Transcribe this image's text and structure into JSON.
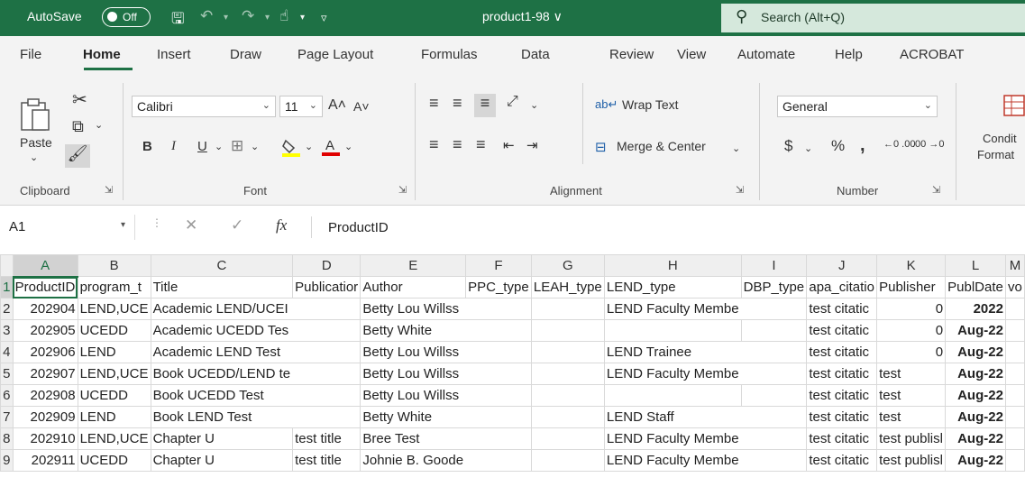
{
  "titlebar": {
    "autosave_label": "AutoSave",
    "autosave_state": "Off",
    "doc_title": "product1-98 ∨",
    "search_placeholder": "Search (Alt+Q)"
  },
  "menu": {
    "tabs": [
      "File",
      "Home",
      "Insert",
      "Draw",
      "Page Layout",
      "Formulas",
      "Data",
      "Review",
      "View",
      "Automate",
      "Help",
      "ACROBAT"
    ],
    "active": "Home"
  },
  "ribbon": {
    "clipboard": {
      "paste_label": "Paste",
      "group_label": "Clipboard"
    },
    "font": {
      "name": "Calibri",
      "size": "11",
      "group_label": "Font"
    },
    "alignment": {
      "wrap_text": "Wrap Text",
      "merge_center": "Merge & Center",
      "group_label": "Alignment"
    },
    "number": {
      "format": "General",
      "group_label": "Number"
    },
    "styles": {
      "conditional_line1": "Condit",
      "conditional_line2": "Format"
    }
  },
  "formula_bar": {
    "name_box": "A1",
    "fx_label": "fx",
    "content": "ProductID"
  },
  "grid": {
    "columns": [
      "A",
      "B",
      "C",
      "D",
      "E",
      "F",
      "G",
      "H",
      "I",
      "J",
      "K",
      "L",
      "M"
    ],
    "rows": [
      [
        "1",
        "ProductID",
        "program_t",
        "Title",
        "Publicatior",
        "Author",
        "PPC_type",
        "LEAH_type",
        "LEND_type",
        "DBP_type",
        "apa_citatio",
        "Publisher",
        "PublDate",
        "vo"
      ],
      [
        "2",
        "202904",
        "LEND,UCE",
        "Academic LEND/UCEI",
        "",
        "Betty Lou Willss",
        "",
        "",
        "LEND Faculty Membe",
        "",
        "test citatic",
        "0",
        "2022",
        ""
      ],
      [
        "3",
        "202905",
        "UCEDD",
        "Academic UCEDD Tes",
        "",
        "Betty White",
        "",
        "",
        "",
        "",
        "test citatic",
        "0",
        "Aug-22",
        ""
      ],
      [
        "4",
        "202906",
        "LEND",
        "Academic LEND Test",
        "",
        "Betty Lou Willss",
        "",
        "",
        "LEND Trainee",
        "",
        "test citatic",
        "0",
        "Aug-22",
        ""
      ],
      [
        "5",
        "202907",
        "LEND,UCE",
        "Book UCEDD/LEND te",
        "",
        "Betty Lou Willss",
        "",
        "",
        "LEND Faculty Membe",
        "",
        "test citatic",
        "test",
        "Aug-22",
        ""
      ],
      [
        "6",
        "202908",
        "UCEDD",
        "Book UCEDD Test",
        "",
        "Betty Lou Willss",
        "",
        "",
        "",
        "",
        "test citatic",
        "test",
        "Aug-22",
        ""
      ],
      [
        "7",
        "202909",
        "LEND",
        "Book LEND Test",
        "",
        "Betty White",
        "",
        "",
        "LEND Staff",
        "",
        "test citatic",
        "test",
        "Aug-22",
        ""
      ],
      [
        "8",
        "202910",
        "LEND,UCE",
        "Chapter U",
        "test title",
        "Bree Test",
        "",
        "",
        "LEND Faculty Membe",
        "",
        "test citatic",
        "test publisl",
        "Aug-22",
        ""
      ],
      [
        "9",
        "202911",
        "UCEDD",
        "Chapter U",
        "test title",
        "Johnie B. Goode",
        "",
        "",
        "LEND Faculty Membe",
        "",
        "test citatic",
        "test publisl",
        "Aug-22",
        ""
      ]
    ]
  },
  "colors": {
    "accent": "#1e7145"
  }
}
